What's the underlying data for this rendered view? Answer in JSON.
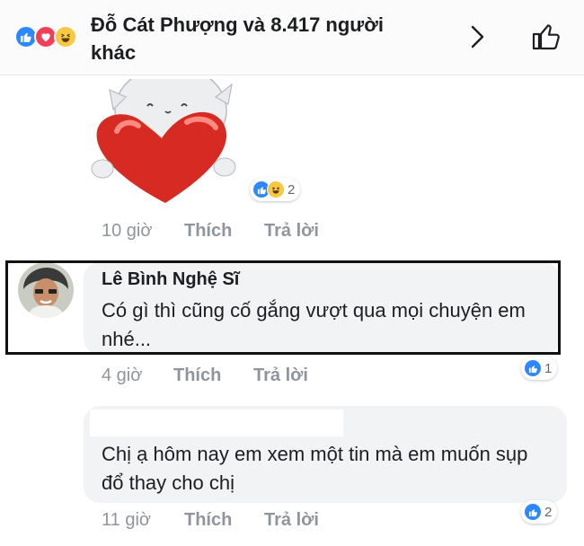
{
  "header": {
    "title": "Đỗ Cát Phượng và 8.417 người khác",
    "reactions": [
      "like-icon",
      "love-icon",
      "haha-icon"
    ]
  },
  "sticker_comment": {
    "reaction_count": "2",
    "time": "10 giờ",
    "like_label": "Thích",
    "reply_label": "Trả lời"
  },
  "comment1": {
    "author": "Lê Bình Nghệ Sĩ",
    "text": "Có gì thì cũng cố gắng vượt qua mọi chuyện em nhé...",
    "time": "4 giờ",
    "like_label": "Thích",
    "reply_label": "Trả lời",
    "reaction_count": "1"
  },
  "comment2": {
    "text": "Chị ạ hôm nay em xem một tin mà em muốn sụp đổ thay cho chị",
    "time": "11 giờ",
    "like_label": "Thích",
    "reply_label": "Trả lời",
    "reaction_count": "2"
  },
  "colors": {
    "like_blue": "#2d88ff",
    "love_red": "#f33e58",
    "haha_yellow": "#f7c843",
    "meta_gray": "#90949c",
    "bubble_bg": "#f2f3f5"
  }
}
